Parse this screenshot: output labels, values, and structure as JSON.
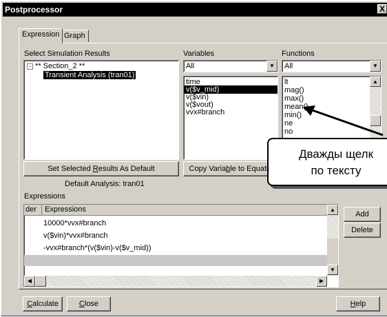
{
  "window": {
    "title": "Postprocessor",
    "close_glyph": "X"
  },
  "tabs": [
    {
      "label": "Expression"
    },
    {
      "label": "Graph"
    }
  ],
  "sim": {
    "label": "Select Simulation Results",
    "tree": {
      "section": "** Section_2 **",
      "collapse_glyph": "-",
      "item": "Transient Analysis (tran01)"
    },
    "set_default_pre": "Set Selected ",
    "set_default_ul": "R",
    "set_default_post": "esults As Default",
    "default_analysis": "Default Analysis: tran01"
  },
  "variables": {
    "label": "Variables",
    "combo_value": "All",
    "items": [
      "time",
      "v($v_mid)",
      "v($vin)",
      "v($vout)",
      "vvx#branch"
    ],
    "selected": "v($v_mid)",
    "copy_pre": "Copy Varia",
    "copy_ul": "b",
    "copy_post": "le to Equatio"
  },
  "functions": {
    "label": "Functions",
    "combo_value": "All",
    "items": [
      "lt",
      "mag()",
      "max()",
      "mean()",
      "min()",
      "ne",
      "no"
    ]
  },
  "expressions": {
    "label": "Expressions",
    "col_order": "der",
    "col_expr": "Expressions",
    "rows": [
      "10000*vvx#branch",
      "v($vin)*vvx#branch",
      "-vvx#branch*(v($vin)-v($v_mid))"
    ],
    "add": "Add",
    "delete": "Delete"
  },
  "bottom": {
    "calc_ul": "C",
    "calc_rest": "alculate",
    "close_ul": "C",
    "close_rest": "lose",
    "help_ul": "H",
    "help_rest": "elp"
  },
  "callout": {
    "line1": "Дважды щелк",
    "line2": "по тексту"
  },
  "icons": {
    "down_arrow": "▼",
    "up_arrow": "▲",
    "left_arrow": "◀",
    "right_arrow": "▶"
  },
  "colors": {
    "window": "#d4d0c8",
    "title": "#000000",
    "selection": "#000000"
  }
}
